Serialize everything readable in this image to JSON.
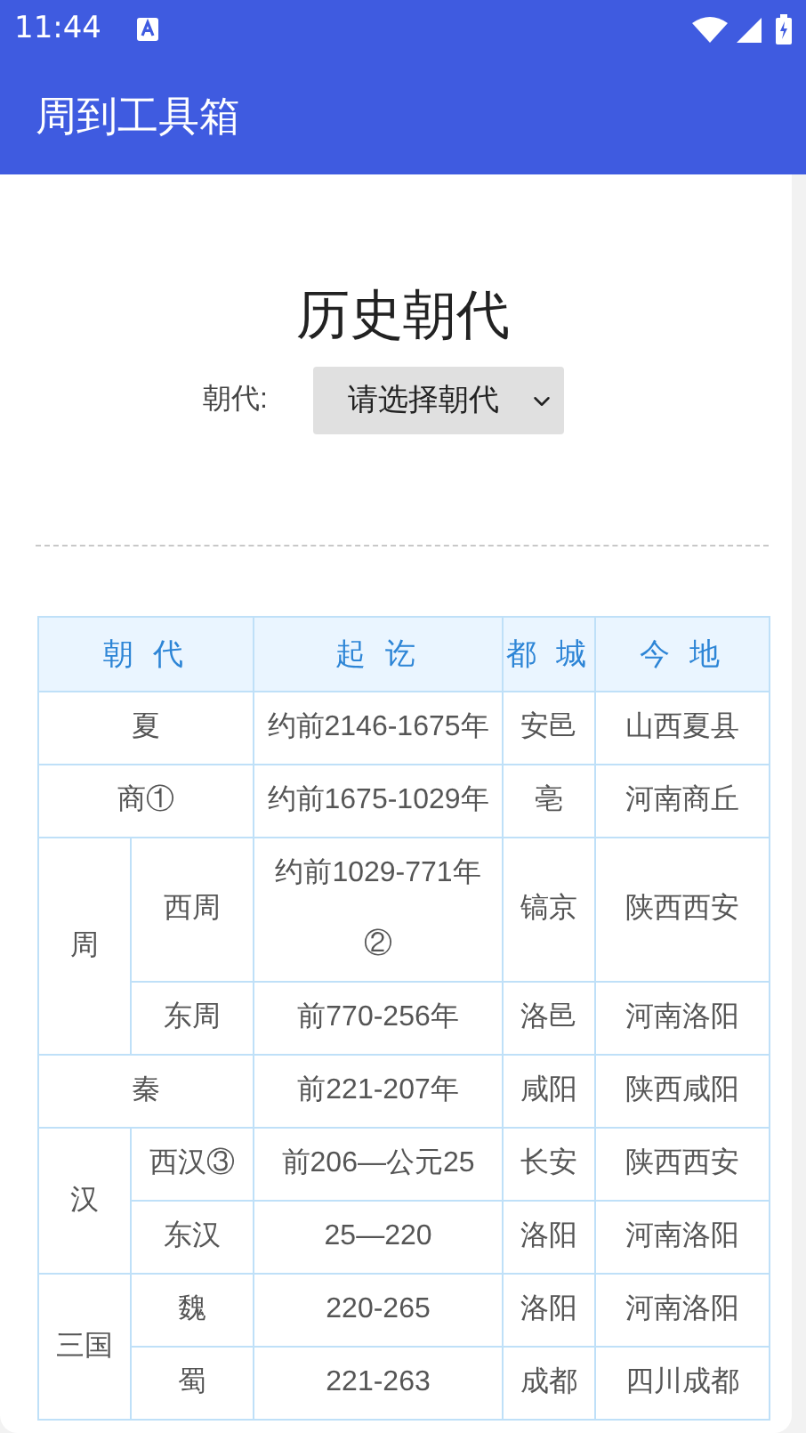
{
  "status_bar": {
    "time": "11:44"
  },
  "app_bar": {
    "title": "周到工具箱"
  },
  "page": {
    "heading": "历史朝代",
    "filter_label": "朝代:",
    "select": {
      "value": "请选择朝代"
    }
  },
  "table": {
    "columns": [
      "朝 代",
      "起 讫",
      "都 城",
      "今 地"
    ],
    "rows": [
      {
        "dynasty": "夏",
        "period": "约前2146-1675年",
        "capital": "安邑",
        "location": "山西夏县"
      },
      {
        "dynasty": "商①",
        "period": "约前1675-1029年",
        "capital": "亳",
        "location": "河南商丘"
      },
      {
        "dynasty": "周",
        "children": [
          {
            "name": "西周",
            "period": "约前1029-771年②",
            "capital": "镐京",
            "location": "陕西西安"
          },
          {
            "name": "东周",
            "period": "前770-256年",
            "capital": "洛邑",
            "location": "河南洛阳"
          }
        ]
      },
      {
        "dynasty": "秦",
        "period": "前221-207年",
        "capital": "咸阳",
        "location": "陕西咸阳"
      },
      {
        "dynasty": "汉",
        "children": [
          {
            "name": "西汉③",
            "period": "前206—公元25",
            "capital": "长安",
            "location": "陕西西安"
          },
          {
            "name": "东汉",
            "period": "25—220",
            "capital": "洛阳",
            "location": "河南洛阳"
          }
        ]
      },
      {
        "dynasty": "三国",
        "children": [
          {
            "name": "魏",
            "period": "220-265",
            "capital": "洛阳",
            "location": "河南洛阳"
          },
          {
            "name": "蜀",
            "period": "221-263",
            "capital": "成都",
            "location": "四川成都"
          }
        ]
      }
    ]
  }
}
